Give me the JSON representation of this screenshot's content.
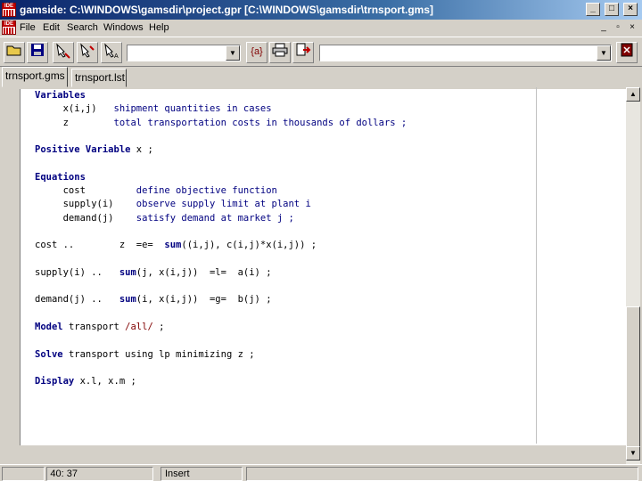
{
  "window": {
    "title": "gamside: C:\\WINDOWS\\gamsdir\\project.gpr   [C:\\WINDOWS\\gamsdir\\trnsport.gms]",
    "app_icon_text": "IDE"
  },
  "menu": {
    "items": [
      "File",
      "Edit",
      "Search",
      "Windows",
      "Help"
    ]
  },
  "toolbar": {
    "combo_left_value": "",
    "combo_right_value": "",
    "model_button_label": "{a}"
  },
  "tabs": [
    {
      "label": "trnsport.gms",
      "active": true
    },
    {
      "label": "trnsport.lst",
      "active": false
    }
  ],
  "code": {
    "lines": [
      [
        {
          "t": "Variables",
          "c": "kw"
        }
      ],
      [
        {
          "t": "     x(i,j)   ",
          "c": "id"
        },
        {
          "t": "shipment quantities in cases",
          "c": "desc"
        }
      ],
      [
        {
          "t": "     z        ",
          "c": "id"
        },
        {
          "t": "total transportation costs in thousands of dollars ;",
          "c": "desc"
        }
      ],
      [],
      [
        {
          "t": "Positive Variable ",
          "c": "kw"
        },
        {
          "t": "x ;",
          "c": "id"
        }
      ],
      [],
      [
        {
          "t": "Equations",
          "c": "kw"
        }
      ],
      [
        {
          "t": "     cost         ",
          "c": "id"
        },
        {
          "t": "define objective function",
          "c": "desc"
        }
      ],
      [
        {
          "t": "     supply(i)    ",
          "c": "id"
        },
        {
          "t": "observe supply limit at plant i",
          "c": "desc"
        }
      ],
      [
        {
          "t": "     demand(j)    ",
          "c": "id"
        },
        {
          "t": "satisfy demand at market j ;",
          "c": "desc"
        }
      ],
      [],
      [
        {
          "t": "cost ..        z  =e=  ",
          "c": "id"
        },
        {
          "t": "sum",
          "c": "fn"
        },
        {
          "t": "((i,j), c(i,j)*x(i,j)) ;",
          "c": "id"
        }
      ],
      [],
      [
        {
          "t": "supply(i) ..   ",
          "c": "id"
        },
        {
          "t": "sum",
          "c": "fn"
        },
        {
          "t": "(j, x(i,j))  =l=  a(i) ;",
          "c": "id"
        }
      ],
      [],
      [
        {
          "t": "demand(j) ..   ",
          "c": "id"
        },
        {
          "t": "sum",
          "c": "fn"
        },
        {
          "t": "(i, x(i,j))  =g=  b(j) ;",
          "c": "id"
        }
      ],
      [],
      [
        {
          "t": "Model ",
          "c": "kw"
        },
        {
          "t": "transport ",
          "c": "id"
        },
        {
          "t": "/all/",
          "c": "lit"
        },
        {
          "t": " ;",
          "c": "id"
        }
      ],
      [],
      [
        {
          "t": "Solve ",
          "c": "kw"
        },
        {
          "t": "transport using lp minimizing z ;",
          "c": "id"
        }
      ],
      [],
      [
        {
          "t": "Display ",
          "c": "kw"
        },
        {
          "t": "x.l, x.m ;",
          "c": "id"
        }
      ]
    ]
  },
  "status": {
    "cursor": "40: 37",
    "mode": "Insert",
    "panel_1": "",
    "panel_4": ""
  },
  "colors": {
    "title_gradient_start": "#0a246a",
    "keyword": "#000080",
    "literal": "#800000"
  }
}
